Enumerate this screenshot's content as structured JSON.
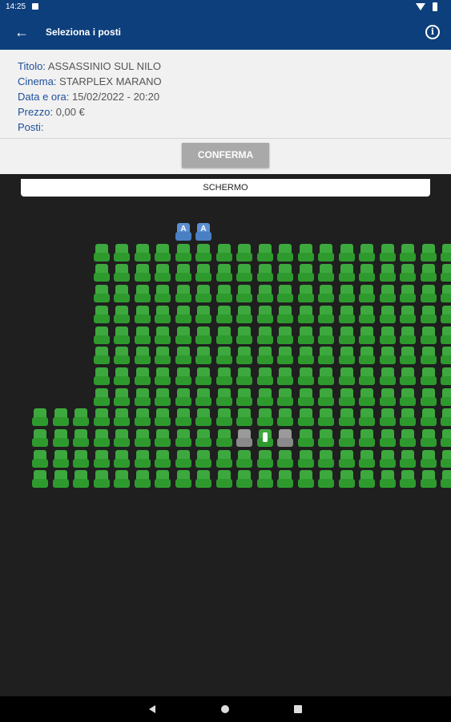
{
  "status_bar": {
    "time": "14:25"
  },
  "app_bar": {
    "back_icon": "←",
    "title": "Seleziona i posti",
    "info_icon": "i"
  },
  "details": [
    {
      "label": "Titolo:",
      "value": "ASSASSINIO SUL NILO"
    },
    {
      "label": "Cinema:",
      "value": "STARPLEX MARANO"
    },
    {
      "label": "Data e ora:",
      "value": "15/02/2022 - 20:20"
    },
    {
      "label": "Prezzo:",
      "value": "0,00 €"
    },
    {
      "label": "Posti:",
      "value": ""
    }
  ],
  "confirm_label": "CONFERMA",
  "screen_label": "SCHERMO",
  "colors": {
    "header": "#0d3f7c",
    "seat_free": "#3da83d",
    "seat_reserved": "#5b8fd2",
    "seat_occupied": "#9a9a9a",
    "hall_background": "#1f1f1f",
    "confirm_button": "#a9a9a9"
  },
  "seat_map": {
    "seat_letter": "A",
    "rows": [
      "       RR            ",
      "   ..................",
      "   ..................",
      "   ..................",
      "   ..................",
      "   ..................",
      "   ..................",
      "   ..................",
      "   ..................",
      ".....................",
      "..........XSX........",
      ".....................",
      "....................."
    ]
  }
}
